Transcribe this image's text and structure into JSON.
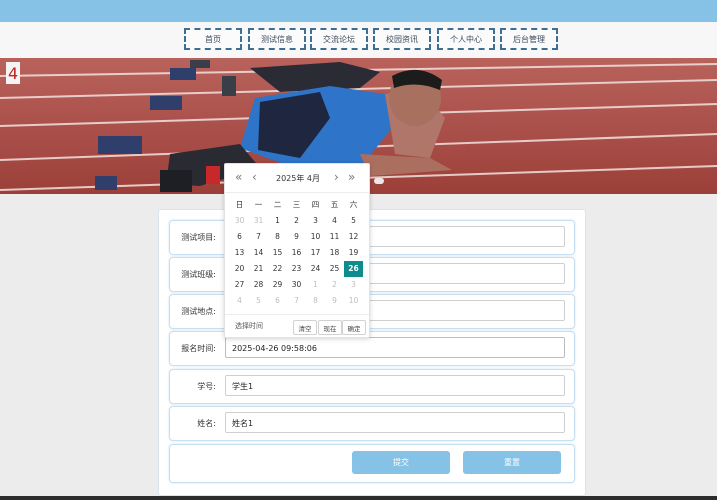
{
  "nav": {
    "items": [
      "首页",
      "测试信息",
      "交流论坛",
      "校园资讯",
      "个人中心",
      "后台管理"
    ]
  },
  "form": {
    "fields": [
      {
        "label": "测试项目:",
        "value": ""
      },
      {
        "label": "测试班级:",
        "value": ""
      },
      {
        "label": "测试地点:",
        "value": ""
      },
      {
        "label": "报名时间:",
        "value": "2025-04-26 09:58:06"
      },
      {
        "label": "学号:",
        "value": "学生1"
      },
      {
        "label": "姓名:",
        "value": "姓名1"
      }
    ],
    "submit_label": "提交",
    "reset_label": "重置"
  },
  "picker": {
    "title": "2025年  4月",
    "weekdays": [
      "日",
      "一",
      "二",
      "三",
      "四",
      "五",
      "六"
    ],
    "weeks": [
      [
        {
          "d": "30",
          "o": true
        },
        {
          "d": "31",
          "o": true
        },
        {
          "d": "1"
        },
        {
          "d": "2"
        },
        {
          "d": "3"
        },
        {
          "d": "4"
        },
        {
          "d": "5"
        }
      ],
      [
        {
          "d": "6"
        },
        {
          "d": "7"
        },
        {
          "d": "8"
        },
        {
          "d": "9"
        },
        {
          "d": "10"
        },
        {
          "d": "11"
        },
        {
          "d": "12"
        }
      ],
      [
        {
          "d": "13"
        },
        {
          "d": "14"
        },
        {
          "d": "15"
        },
        {
          "d": "16"
        },
        {
          "d": "17"
        },
        {
          "d": "18"
        },
        {
          "d": "19"
        }
      ],
      [
        {
          "d": "20"
        },
        {
          "d": "21"
        },
        {
          "d": "22"
        },
        {
          "d": "23"
        },
        {
          "d": "24"
        },
        {
          "d": "25"
        },
        {
          "d": "26",
          "sel": true
        }
      ],
      [
        {
          "d": "27"
        },
        {
          "d": "28"
        },
        {
          "d": "29"
        },
        {
          "d": "30"
        },
        {
          "d": "1",
          "o": true
        },
        {
          "d": "2",
          "o": true
        },
        {
          "d": "3",
          "o": true
        }
      ],
      [
        {
          "d": "4",
          "o": true
        },
        {
          "d": "5",
          "o": true
        },
        {
          "d": "6",
          "o": true
        },
        {
          "d": "7",
          "o": true
        },
        {
          "d": "8",
          "o": true
        },
        {
          "d": "9",
          "o": true
        },
        {
          "d": "10",
          "o": true
        }
      ]
    ],
    "select_time_label": "选择时间",
    "clear_label": "清空",
    "now_label": "现在",
    "confirm_label": "确定"
  },
  "colors": {
    "accent": "#86c1e6",
    "selected_day": "#0e8b8b"
  }
}
